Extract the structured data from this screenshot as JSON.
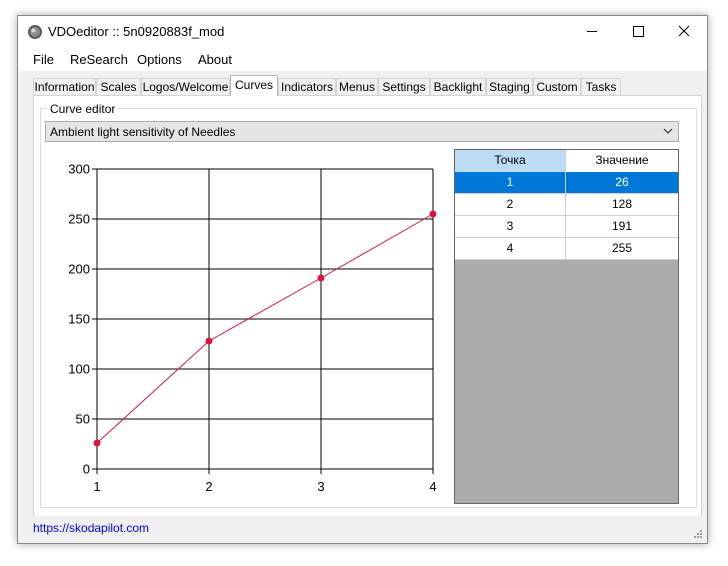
{
  "window": {
    "title": "VDOeditor :: 5n0920883f_mod",
    "icon": "app-disc-icon"
  },
  "menu": [
    "File",
    "ReSearch",
    "Options",
    "About"
  ],
  "tabs": [
    {
      "label": "Information",
      "active": false
    },
    {
      "label": "Scales",
      "active": false
    },
    {
      "label": "Logos/Welcome",
      "active": false
    },
    {
      "label": "Curves",
      "active": true
    },
    {
      "label": "Indicators",
      "active": false
    },
    {
      "label": "Menus",
      "active": false
    },
    {
      "label": "Settings",
      "active": false
    },
    {
      "label": "Backlight",
      "active": false
    },
    {
      "label": "Staging",
      "active": false
    },
    {
      "label": "Custom",
      "active": false
    },
    {
      "label": "Tasks",
      "active": false
    }
  ],
  "curve_editor": {
    "group_label": "Curve editor",
    "selected_curve": "Ambient light sensitivity of Needles"
  },
  "chart_data": {
    "type": "line",
    "x": [
      1,
      2,
      3,
      4
    ],
    "values": [
      26,
      128,
      191,
      255
    ],
    "xlim": [
      1,
      4
    ],
    "ylim": [
      0,
      300
    ],
    "x_ticks": [
      "1",
      "2",
      "3",
      "4"
    ],
    "y_ticks": [
      "0",
      "50",
      "100",
      "150",
      "200",
      "250",
      "300"
    ],
    "grid": true,
    "line_color": "#dc143c"
  },
  "table": {
    "columns": [
      "Точка",
      "Значение"
    ],
    "rows": [
      {
        "point": "1",
        "value": "26",
        "selected": true
      },
      {
        "point": "2",
        "value": "128",
        "selected": false
      },
      {
        "point": "3",
        "value": "191",
        "selected": false
      },
      {
        "point": "4",
        "value": "255",
        "selected": false
      }
    ]
  },
  "status": {
    "link": "https://skodapilot.com"
  },
  "colors": {
    "selection": "#0078d7",
    "header_highlight": "#bcdcf4",
    "empty_grid": "#ababab"
  }
}
